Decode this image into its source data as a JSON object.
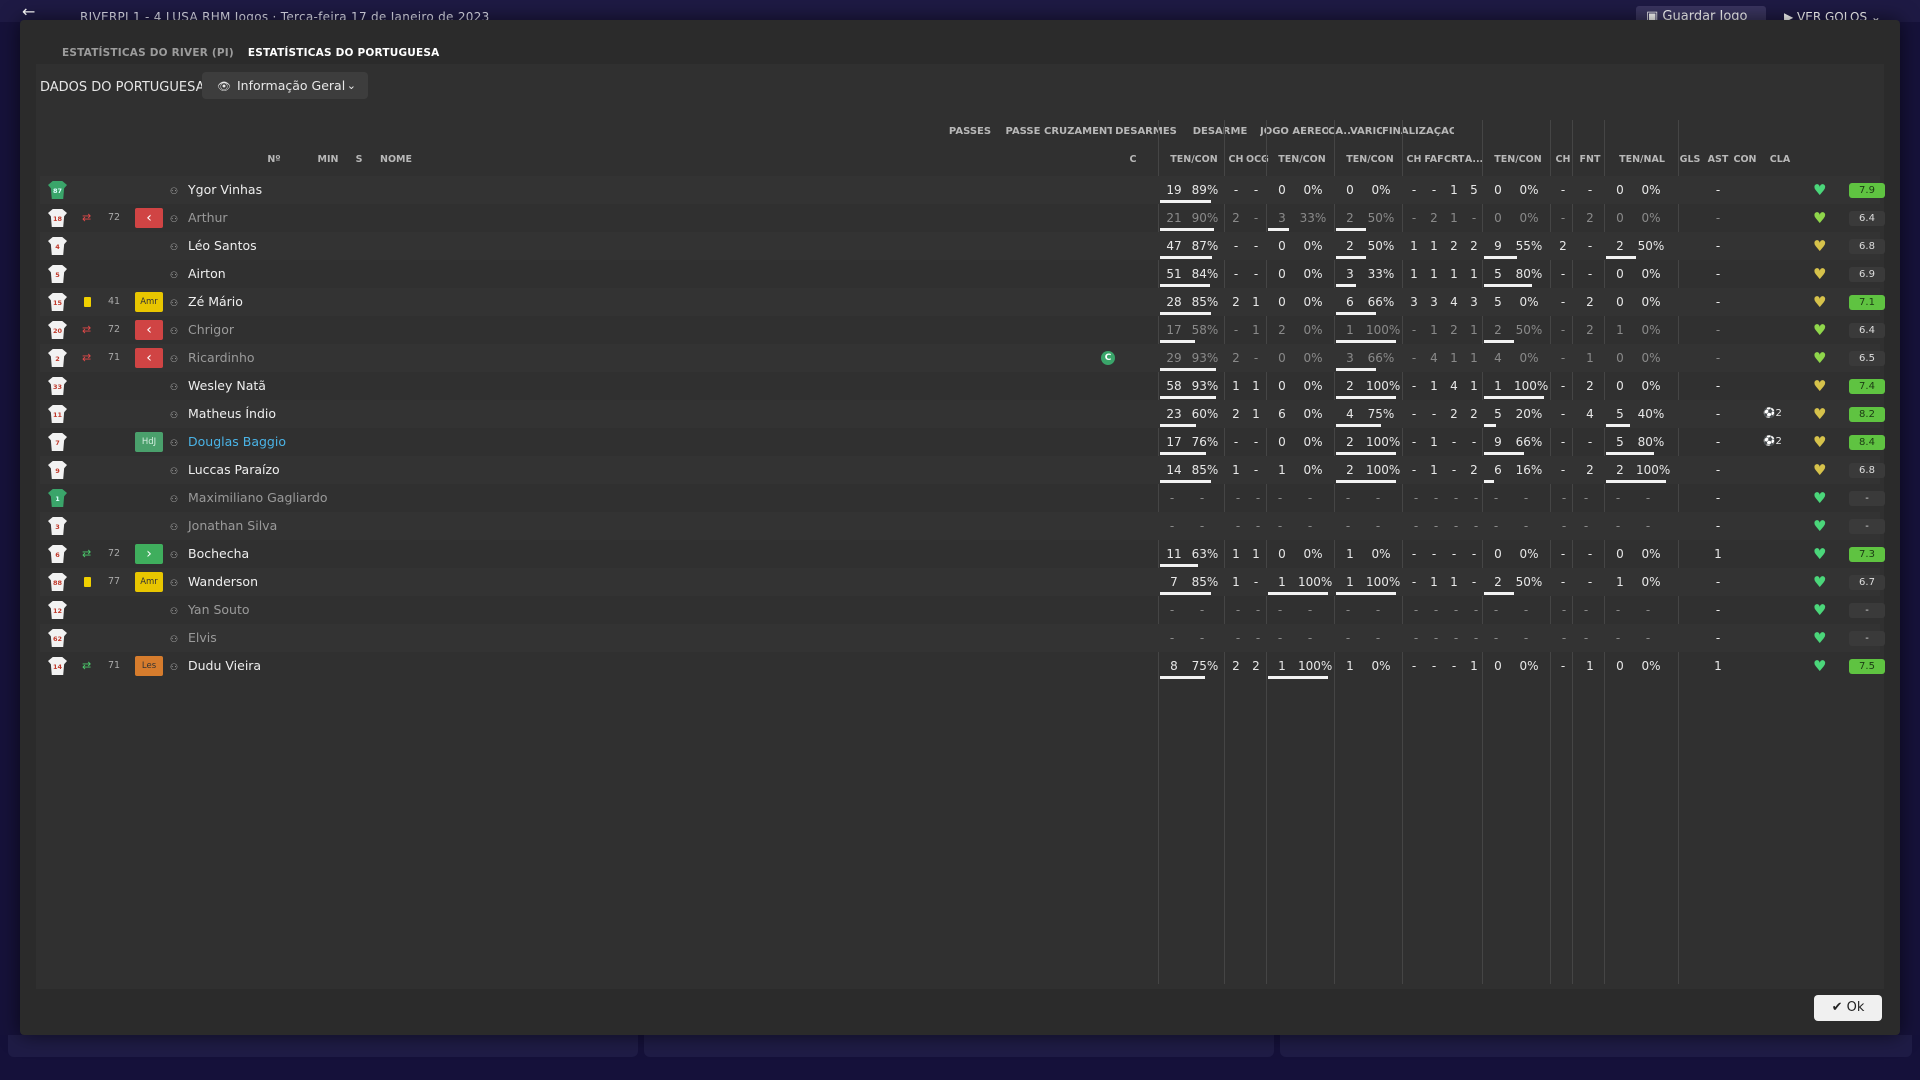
{
  "background": {
    "match_title": "RIVERPI  1 - 4  LUSA    RHM Jogos  ·  Terça-feira 17 de Janeiro de 2023",
    "save_label": "Guardar Jogo",
    "goals_label": "VER GOLOS"
  },
  "tabs": [
    "ESTATÍSTICAS DO RIVER (PI)",
    "ESTATÍSTICAS DO PORTUGUESA"
  ],
  "section_label": "DADOS DO PORTUGUESA",
  "view_select": "Informação Geral",
  "groups": {
    "passes": "PASSES",
    "passe": "PASSE",
    "cruzamentos": "CRUZAMENTOS",
    "desarmes": "DESARMES",
    "desarme": "DESARME",
    "jogo_aereo": "JOGO AÉREO",
    "ca": "CA...",
    "varios": "VÁRIOS",
    "finalizacao": "FINALIZAÇÃO"
  },
  "columns": {
    "num": "Nº",
    "min": "MIN",
    "s": "S",
    "nome": "NOME",
    "c": "C",
    "passes_tc": "TEN/CON",
    "passe_ch": "CH",
    "passe_ocg": "OCG",
    "cruz_tc": "TEN/CON",
    "des_tc": "TEN/CON",
    "desm_ch": "CH",
    "desm_faf": "FAF",
    "desm_crt": "CRT",
    "desm_a": "A...",
    "ja_tc": "TEN/CON",
    "ca_ch": "CH",
    "varios_fnt": "FNT",
    "fin_tn": "TEN/NAL",
    "gls": "GLS",
    "ast": "AST",
    "con": "CON",
    "cla": "CLA"
  },
  "players": [
    {
      "num": "87",
      "gk": true,
      "sub": "",
      "card": false,
      "min": "",
      "s": "",
      "name": "Ygor Vinhas",
      "style": "",
      "cap": false,
      "p": [
        "19",
        "89%"
      ],
      "pch": "-",
      "pocg": "-",
      "cr": [
        "0",
        "0%"
      ],
      "de": [
        "0",
        "0%"
      ],
      "dch": "-",
      "dfaf": "-",
      "dcrt": "1",
      "da": "5",
      "ja": [
        "0",
        "0%"
      ],
      "cach": "-",
      "fnt": "-",
      "fin": [
        "0",
        "0%"
      ],
      "gls": "",
      "ast": "-",
      "heart": "#4bd67a",
      "cla": "7.9",
      "good": true,
      "bars": [
        0.85,
        0,
        0,
        0,
        0
      ]
    },
    {
      "num": "18",
      "gk": false,
      "sub": "out",
      "card": false,
      "min": "72",
      "s": "red",
      "name": "Arthur",
      "style": "gray",
      "cap": false,
      "p": [
        "21",
        "90%"
      ],
      "pch": "2",
      "pocg": "-",
      "cr": [
        "3",
        "33%"
      ],
      "de": [
        "2",
        "50%"
      ],
      "dch": "-",
      "dfaf": "2",
      "dcrt": "1",
      "da": "-",
      "ja": [
        "0",
        "0%"
      ],
      "cach": "-",
      "fnt": "2",
      "fin": [
        "0",
        "0%"
      ],
      "gls": "",
      "ast": "-",
      "heart": "#8fd64b",
      "cla": "6.4",
      "good": false,
      "bars": [
        0.9,
        0.35,
        0.5,
        0,
        0
      ],
      "dim": true
    },
    {
      "num": "4",
      "gk": false,
      "sub": "",
      "card": false,
      "min": "",
      "s": "",
      "name": "Léo Santos",
      "style": "",
      "cap": false,
      "p": [
        "47",
        "87%"
      ],
      "pch": "-",
      "pocg": "-",
      "cr": [
        "0",
        "0%"
      ],
      "de": [
        "2",
        "50%"
      ],
      "dch": "1",
      "dfaf": "1",
      "dcrt": "2",
      "da": "2",
      "ja": [
        "9",
        "55%"
      ],
      "cach": "2",
      "fnt": "-",
      "fin": [
        "2",
        "50%"
      ],
      "gls": "",
      "ast": "-",
      "heart": "#d6c24b",
      "cla": "6.8",
      "good": false,
      "bars": [
        0.87,
        0,
        0.5,
        0.55,
        0.5
      ]
    },
    {
      "num": "5",
      "gk": false,
      "sub": "",
      "card": false,
      "min": "",
      "s": "",
      "name": "Airton",
      "style": "",
      "cap": false,
      "p": [
        "51",
        "84%"
      ],
      "pch": "-",
      "pocg": "-",
      "cr": [
        "0",
        "0%"
      ],
      "de": [
        "3",
        "33%"
      ],
      "dch": "1",
      "dfaf": "1",
      "dcrt": "1",
      "da": "1",
      "ja": [
        "5",
        "80%"
      ],
      "cach": "-",
      "fnt": "-",
      "fin": [
        "0",
        "0%"
      ],
      "gls": "",
      "ast": "-",
      "heart": "#d6c24b",
      "cla": "6.9",
      "good": false,
      "bars": [
        0.84,
        0,
        0.33,
        0.8,
        0
      ]
    },
    {
      "num": "15",
      "gk": false,
      "sub": "",
      "card": true,
      "min": "41",
      "s": "yel",
      "sbadge": "Amr",
      "name": "Zé Mário",
      "style": "",
      "cap": false,
      "p": [
        "28",
        "85%"
      ],
      "pch": "2",
      "pocg": "1",
      "cr": [
        "0",
        "0%"
      ],
      "de": [
        "6",
        "66%"
      ],
      "dch": "3",
      "dfaf": "3",
      "dcrt": "4",
      "da": "3",
      "ja": [
        "5",
        "0%"
      ],
      "cach": "-",
      "fnt": "2",
      "fin": [
        "0",
        "0%"
      ],
      "gls": "",
      "ast": "-",
      "heart": "#d6c24b",
      "cla": "7.1",
      "good": true,
      "bars": [
        0.85,
        0,
        0.66,
        0,
        0
      ]
    },
    {
      "num": "20",
      "gk": false,
      "sub": "out",
      "card": false,
      "min": "72",
      "s": "red",
      "name": "Chrigor",
      "style": "gray",
      "cap": false,
      "p": [
        "17",
        "58%"
      ],
      "pch": "-",
      "pocg": "1",
      "cr": [
        "2",
        "0%"
      ],
      "de": [
        "1",
        "100%"
      ],
      "dch": "-",
      "dfaf": "1",
      "dcrt": "2",
      "da": "1",
      "ja": [
        "2",
        "50%"
      ],
      "cach": "-",
      "fnt": "2",
      "fin": [
        "1",
        "0%"
      ],
      "gls": "",
      "ast": "-",
      "heart": "#8fd64b",
      "cla": "6.4",
      "good": false,
      "bars": [
        0.58,
        0,
        1,
        0.5,
        0
      ],
      "dim": true
    },
    {
      "num": "2",
      "gk": false,
      "sub": "out",
      "card": false,
      "min": "71",
      "s": "red",
      "name": "Ricardinho",
      "style": "gray",
      "cap": true,
      "p": [
        "29",
        "93%"
      ],
      "pch": "2",
      "pocg": "-",
      "cr": [
        "0",
        "0%"
      ],
      "de": [
        "3",
        "66%"
      ],
      "dch": "-",
      "dfaf": "4",
      "dcrt": "1",
      "da": "1",
      "ja": [
        "4",
        "0%"
      ],
      "cach": "-",
      "fnt": "1",
      "fin": [
        "0",
        "0%"
      ],
      "gls": "",
      "ast": "-",
      "heart": "#8fd64b",
      "cla": "6.5",
      "good": false,
      "bars": [
        0.93,
        0,
        0.66,
        0,
        0
      ],
      "dim": true
    },
    {
      "num": "33",
      "gk": false,
      "sub": "",
      "card": false,
      "min": "",
      "s": "",
      "name": "Wesley Natã",
      "style": "",
      "cap": false,
      "p": [
        "58",
        "93%"
      ],
      "pch": "1",
      "pocg": "1",
      "cr": [
        "0",
        "0%"
      ],
      "de": [
        "2",
        "100%"
      ],
      "dch": "-",
      "dfaf": "1",
      "dcrt": "4",
      "da": "1",
      "ja": [
        "1",
        "100%"
      ],
      "cach": "-",
      "fnt": "2",
      "fin": [
        "0",
        "0%"
      ],
      "gls": "",
      "ast": "-",
      "heart": "#d6c24b",
      "cla": "7.4",
      "good": true,
      "bars": [
        0.93,
        0,
        1,
        1,
        0
      ]
    },
    {
      "num": "11",
      "gk": false,
      "sub": "",
      "card": false,
      "min": "",
      "s": "",
      "name": "Matheus Índio",
      "style": "",
      "cap": false,
      "p": [
        "23",
        "60%"
      ],
      "pch": "2",
      "pocg": "1",
      "cr": [
        "6",
        "0%"
      ],
      "de": [
        "4",
        "75%"
      ],
      "dch": "-",
      "dfaf": "-",
      "dcrt": "2",
      "da": "2",
      "ja": [
        "5",
        "20%"
      ],
      "cach": "-",
      "fnt": "4",
      "fin": [
        "5",
        "40%"
      ],
      "gls": "2",
      "ast": "-",
      "heart": "#d6c24b",
      "cla": "8.2",
      "good": true,
      "bars": [
        0.6,
        0,
        0.75,
        0.2,
        0.4
      ]
    },
    {
      "num": "7",
      "gk": false,
      "sub": "",
      "card": false,
      "min": "",
      "s": "hdj",
      "sbadge": "HdJ",
      "name": "Douglas Baggio",
      "style": "hl",
      "cap": false,
      "p": [
        "17",
        "76%"
      ],
      "pch": "-",
      "pocg": "-",
      "cr": [
        "0",
        "0%"
      ],
      "de": [
        "2",
        "100%"
      ],
      "dch": "-",
      "dfaf": "1",
      "dcrt": "-",
      "da": "-",
      "ja": [
        "9",
        "66%"
      ],
      "cach": "-",
      "fnt": "-",
      "fin": [
        "5",
        "80%"
      ],
      "gls": "2",
      "ast": "-",
      "heart": "#d6c24b",
      "cla": "8.4",
      "good": true,
      "bars": [
        0.76,
        0,
        1,
        0.66,
        0.8
      ],
      "teal": true
    },
    {
      "num": "9",
      "gk": false,
      "sub": "",
      "card": false,
      "min": "",
      "s": "",
      "name": "Luccas Paraízo",
      "style": "",
      "cap": false,
      "p": [
        "14",
        "85%"
      ],
      "pch": "1",
      "pocg": "-",
      "cr": [
        "1",
        "0%"
      ],
      "de": [
        "2",
        "100%"
      ],
      "dch": "-",
      "dfaf": "1",
      "dcrt": "-",
      "da": "2",
      "ja": [
        "6",
        "16%"
      ],
      "cach": "-",
      "fnt": "2",
      "fin": [
        "2",
        "100%"
      ],
      "gls": "",
      "ast": "-",
      "heart": "#d6c24b",
      "cla": "6.8",
      "good": false,
      "bars": [
        0.85,
        0,
        1,
        0.16,
        1
      ]
    },
    {
      "num": "1",
      "gk": true,
      "sub": "",
      "card": false,
      "min": "",
      "s": "",
      "name": "Maximiliano Gagliardo",
      "style": "gray",
      "cap": false,
      "empty": true,
      "gls": "",
      "ast": "-",
      "heart": "#4bd67a",
      "cla": "-",
      "good": false
    },
    {
      "num": "3",
      "gk": false,
      "sub": "",
      "card": false,
      "min": "",
      "s": "",
      "name": "Jonathan Silva",
      "style": "gray",
      "cap": false,
      "empty": true,
      "gls": "",
      "ast": "-",
      "heart": "#4bd67a",
      "cla": "-",
      "good": false
    },
    {
      "num": "6",
      "gk": false,
      "sub": "in",
      "card": false,
      "min": "72",
      "s": "green",
      "name": "Bochecha",
      "style": "",
      "cap": false,
      "p": [
        "11",
        "63%"
      ],
      "pch": "1",
      "pocg": "1",
      "cr": [
        "0",
        "0%"
      ],
      "de": [
        "1",
        "0%"
      ],
      "dch": "-",
      "dfaf": "-",
      "dcrt": "-",
      "da": "-",
      "ja": [
        "0",
        "0%"
      ],
      "cach": "-",
      "fnt": "-",
      "fin": [
        "0",
        "0%"
      ],
      "gls": "",
      "ast": "1",
      "heart": "#4bd67a",
      "cla": "7.3",
      "good": true,
      "bars": [
        0.63,
        0,
        0,
        0,
        0
      ]
    },
    {
      "num": "88",
      "gk": false,
      "sub": "",
      "card": true,
      "min": "77",
      "s": "yel",
      "sbadge": "Amr",
      "name": "Wanderson",
      "style": "",
      "cap": false,
      "p": [
        "7",
        "85%"
      ],
      "pch": "1",
      "pocg": "-",
      "cr": [
        "1",
        "100%"
      ],
      "de": [
        "1",
        "100%"
      ],
      "dch": "-",
      "dfaf": "1",
      "dcrt": "1",
      "da": "-",
      "ja": [
        "2",
        "50%"
      ],
      "cach": "-",
      "fnt": "-",
      "fin": [
        "1",
        "0%"
      ],
      "gls": "",
      "ast": "-",
      "heart": "#4bd67a",
      "cla": "6.7",
      "good": false,
      "bars": [
        0.85,
        1,
        1,
        0.5,
        0
      ]
    },
    {
      "num": "12",
      "gk": false,
      "sub": "",
      "card": false,
      "min": "",
      "s": "",
      "name": "Yan Souto",
      "style": "gray",
      "cap": false,
      "empty": true,
      "gls": "",
      "ast": "-",
      "heart": "#4bd67a",
      "cla": "-",
      "good": false
    },
    {
      "num": "62",
      "gk": false,
      "sub": "",
      "card": false,
      "min": "",
      "s": "",
      "name": "Elvis",
      "style": "gray",
      "cap": false,
      "empty": true,
      "gls": "",
      "ast": "-",
      "heart": "#4bd67a",
      "cla": "-",
      "good": false
    },
    {
      "num": "14",
      "gk": false,
      "sub": "in",
      "card": false,
      "min": "71",
      "s": "orange",
      "sbadge": "Les",
      "name": "Dudu Vieira",
      "style": "",
      "cap": false,
      "p": [
        "8",
        "75%"
      ],
      "pch": "2",
      "pocg": "2",
      "cr": [
        "1",
        "100%"
      ],
      "de": [
        "1",
        "0%"
      ],
      "dch": "-",
      "dfaf": "-",
      "dcrt": "-",
      "da": "1",
      "ja": [
        "0",
        "0%"
      ],
      "cach": "-",
      "fnt": "1",
      "fin": [
        "0",
        "0%"
      ],
      "gls": "",
      "ast": "1",
      "heart": "#4bd67a",
      "cla": "7.5",
      "good": true,
      "bars": [
        0.75,
        1,
        0,
        0,
        0
      ]
    }
  ],
  "captain_label": "C",
  "ok_label": "Ok"
}
